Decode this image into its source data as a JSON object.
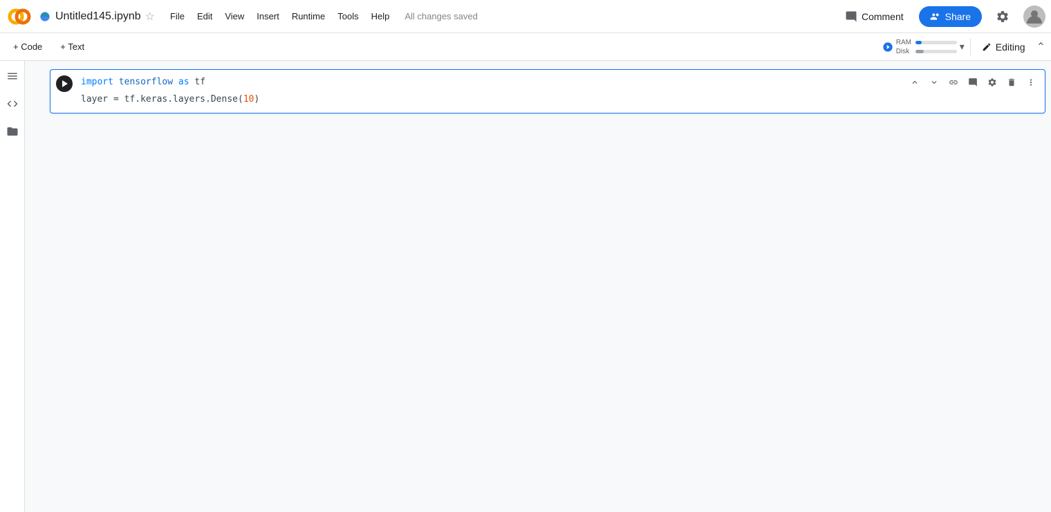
{
  "topbar": {
    "logo_text": "CO",
    "file_name": "Untitled145.ipynb",
    "drive_icon": "📄",
    "star_icon": "☆",
    "menu_items": [
      "File",
      "Edit",
      "View",
      "Insert",
      "Runtime",
      "Tools",
      "Help"
    ],
    "autosave": "All changes saved",
    "comment_label": "Comment",
    "share_label": "Share",
    "editing_label": "Editing"
  },
  "toolbar": {
    "add_code": "+ Code",
    "add_text": "+ Text",
    "ram_label": "RAM",
    "disk_label": "Disk",
    "ram_pct": 15,
    "disk_pct": 20,
    "editing_label": "Editing"
  },
  "cell": {
    "code_line1_import": "import ",
    "code_line1_module": "tensorflow",
    "code_line1_as": " as ",
    "code_line1_alias": "tf",
    "code_line2": "layer = tf.keras.layers.Dense(10)"
  },
  "sidebar": {
    "icons": [
      "≡",
      "◁▷",
      "📁"
    ]
  }
}
